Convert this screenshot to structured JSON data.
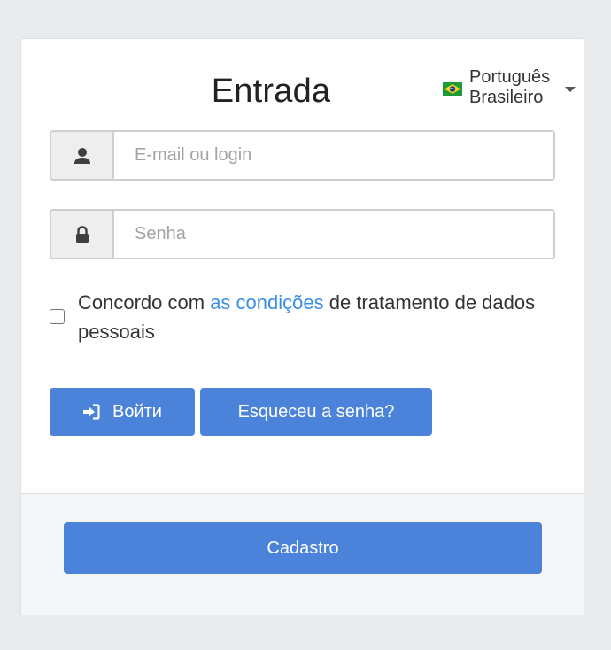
{
  "login": {
    "title": "Entrada",
    "language": {
      "label": "Português Brasileiro",
      "flag_icon": "brazil-flag-icon"
    },
    "login_field": {
      "placeholder": "E-mail ou login",
      "value": "",
      "icon": "user-icon"
    },
    "password_field": {
      "placeholder": "Senha",
      "value": "",
      "icon": "lock-icon"
    },
    "consent": {
      "checked": false,
      "prefix": "Concordo com ",
      "link_text": "as condições",
      "suffix": " de tratamento de dados pessoais"
    },
    "login_button": {
      "label": "Войти",
      "icon": "sign-in-icon"
    },
    "forgot_button": {
      "label": "Esqueceu a senha?"
    }
  },
  "footer": {
    "register_button": {
      "label": "Cadastro"
    }
  },
  "colors": {
    "primary": "#4a83d9",
    "link": "#3b8ee4",
    "background": "#e9eaec",
    "card": "#ffffff",
    "footer": "#f5f6f8"
  }
}
